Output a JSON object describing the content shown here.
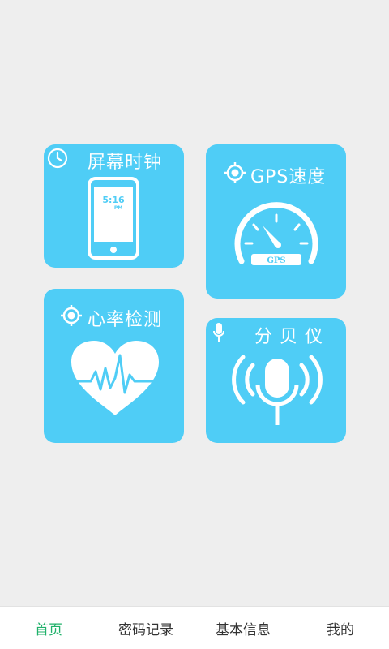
{
  "colors": {
    "background": "#eeeeee",
    "tile": "#4fcdf6",
    "tab_active": "#1fb16a",
    "tab_text": "#333333"
  },
  "tiles": {
    "clock": {
      "title": "屏幕时钟",
      "phone_time": "5:16",
      "phone_ampm": "PM",
      "icon": "clock-icon"
    },
    "gps": {
      "title": "GPS速度",
      "gauge_label": "GPS",
      "icon": "target-icon"
    },
    "heart": {
      "title": "心率检测",
      "icon": "target-icon"
    },
    "decibel": {
      "title": "分 贝 仪",
      "icon": "microphone-icon"
    }
  },
  "tabs": [
    {
      "label": "首页",
      "active": true
    },
    {
      "label": "密码记录",
      "active": false
    },
    {
      "label": "基本信息",
      "active": false
    },
    {
      "label": "我的",
      "active": false
    }
  ]
}
